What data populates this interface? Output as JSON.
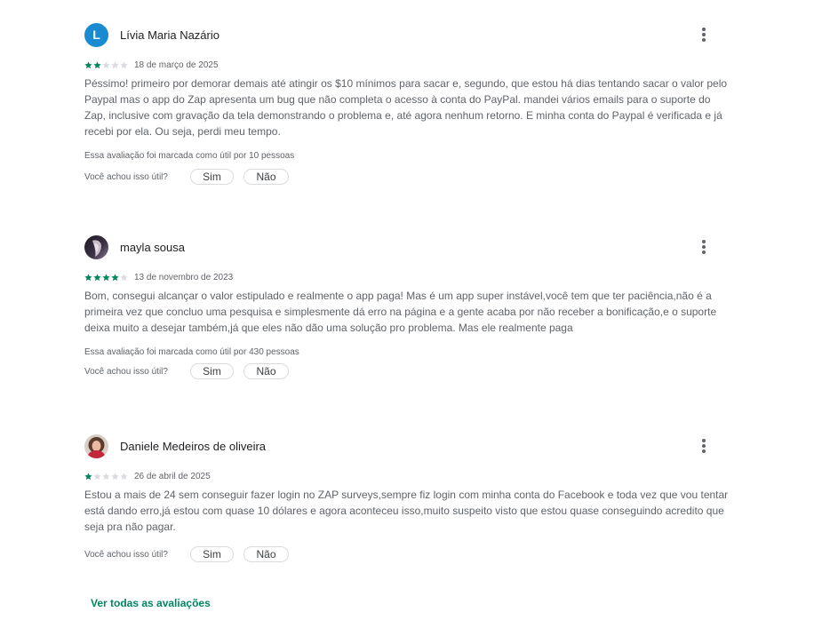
{
  "reviews": [
    {
      "author": "Lívia Maria Nazário",
      "avatar_letter": "L",
      "rating": 2,
      "date": "18 de março de 2025",
      "text": "Péssimo! primeiro por demorar demais até atingir os $10 mínimos para sacar e, segundo, que estou há dias tentando sacar o valor pelo Paypal mas o app do Zap apresenta um bug que não completa o acesso à conta do PayPal. mandei vários emails para o suporte do Zap, inclusive com gravação da tela demonstrando o problema e, até agora nenhum retorno. E minha conta do Paypal é verificada e já recebi por ela. Ou seja, perdi meu tempo.",
      "helpful_count_text": "Essa avaliação foi marcada como útil por 10 pessoas",
      "helpful_question": "Você achou isso útil?",
      "yes_label": "Sim",
      "no_label": "Não"
    },
    {
      "author": "mayla sousa",
      "rating": 4,
      "date": "13 de novembro de 2023",
      "text": "Bom, consegui alcançar o valor estipulado e realmente o app paga! Mas é um app super instável,você tem que ter paciência,não é a primeira vez que concluo uma pesquisa e simplesmente dá erro na página e a gente acaba por não receber a bonificação,e o suporte deixa muito a desejar também,já que eles não dão uma solução pro problema. Mas ele realmente paga",
      "helpful_count_text": "Essa avaliação foi marcada como útil por 430 pessoas",
      "helpful_question": "Você achou isso útil?",
      "yes_label": "Sim",
      "no_label": "Não"
    },
    {
      "author": "Daniele Medeiros de oliveira",
      "rating": 1,
      "date": "26 de abril de 2025",
      "text": "Estou a mais de 24 sem conseguir fazer login no ZAP surveys,sempre fiz login com minha conta do Facebook e toda vez que vou tentar está dando erro,já estou com quase 10 dólares e agora aconteceu isso,muito suspeito visto que estou quase conseguindo acredito que seja pra não pagar.",
      "helpful_question": "Você achou isso útil?",
      "yes_label": "Sim",
      "no_label": "Não"
    }
  ],
  "see_all_label": "Ver todas as avaliações",
  "colors": {
    "star_on": "#01875f",
    "star_off": "#dadce0",
    "avatar_letter_bg": "#1a8bd0",
    "link": "#01875f"
  },
  "icons": {
    "more": "more-vert-icon",
    "star": "star-icon"
  }
}
